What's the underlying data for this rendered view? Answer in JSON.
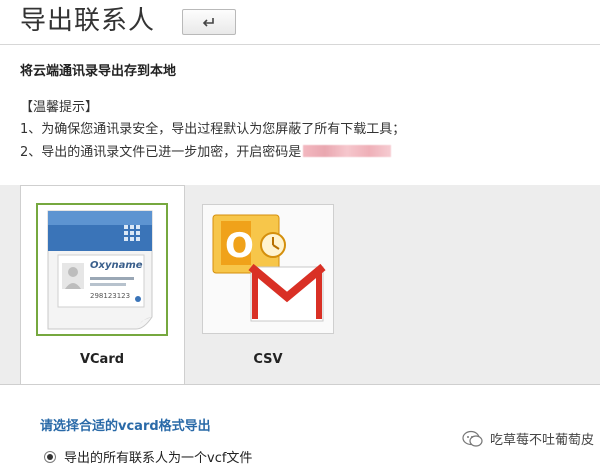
{
  "header": {
    "title": "导出联系人"
  },
  "info": {
    "subtitle": "将云端通讯录导出存到本地",
    "tips_title": "【温馨提示】",
    "tip1": "1、为确保您通讯录安全，导出过程默认为您屏蔽了所有下载工具；",
    "tip2": "2、导出的通讯录文件已进一步加密，开启密码是"
  },
  "formats": {
    "vcard_label": "VCard",
    "csv_label": "CSV",
    "vcard_card_brand": "Oxyname",
    "vcard_card_number": "298123123"
  },
  "options": {
    "choose_label": "请选择合适的vcard格式导出",
    "option1": "导出的所有联系人为一个vcf文件"
  },
  "watermark": {
    "text": "吃草莓不吐葡萄皮"
  },
  "colors": {
    "selected_border": "#76a83f",
    "link_blue": "#2a6aa8",
    "outlook_orange": "#f0a21a",
    "gmail_red": "#d93025"
  },
  "icons": {
    "back": "return-arrow-icon",
    "vcard": "vcard-contact-icon",
    "csv": "outlook-gmail-icon",
    "watermark": "wechat-icon"
  }
}
